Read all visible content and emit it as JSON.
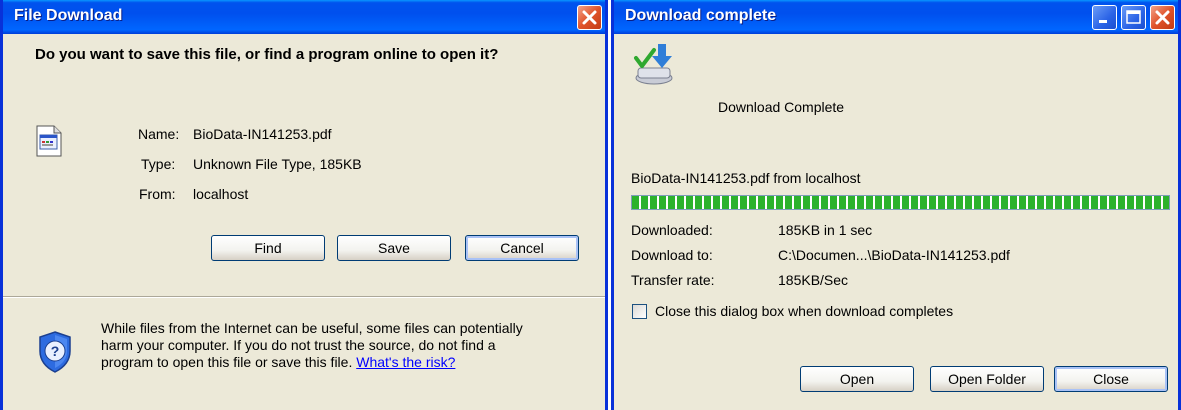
{
  "file_download": {
    "title": "File Download",
    "question": "Do you want to save this file, or find a program online to open it?",
    "name_label": "Name:",
    "name_value": "BioData-IN141253.pdf",
    "type_label": "Type:",
    "type_value": "Unknown File Type, 185KB",
    "from_label": "From:",
    "from_value": "localhost",
    "buttons": {
      "find": "Find",
      "save": "Save",
      "cancel": "Cancel"
    },
    "warning_line1": "While files from the Internet can be useful, some files can potentially",
    "warning_line2": "harm your computer. If you do not trust the source, do not find a",
    "warning_line3": "program to open this file or save this file.",
    "risk_link": "What's the risk?",
    "icons": {
      "file": "generic-file-icon",
      "shield": "security-shield-icon",
      "close": "close-icon"
    }
  },
  "download_complete": {
    "title": "Download complete",
    "heading": "Download Complete",
    "file_line": "BioData-IN141253.pdf from localhost",
    "progress_fraction": 1.0,
    "downloaded_label": "Downloaded:",
    "downloaded_value": "185KB in 1 sec",
    "download_to_label": "Download to:",
    "download_to_value": "C:\\Documen...\\BioData-IN141253.pdf",
    "transfer_rate_label": "Transfer rate:",
    "transfer_rate_value": "185KB/Sec",
    "close_checkbox_label": "Close this dialog box when download completes",
    "close_checkbox_checked": false,
    "buttons": {
      "open": "Open",
      "open_folder": "Open Folder",
      "close": "Close"
    },
    "icons": {
      "complete": "download-complete-icon",
      "minimize": "minimize-icon",
      "maximize": "maximize-icon",
      "close": "close-icon"
    }
  },
  "colors": {
    "titlebar": "#0058ee",
    "dialog_bg": "#ece9d8",
    "progress": "#2cb22c",
    "link": "#0000ff"
  }
}
